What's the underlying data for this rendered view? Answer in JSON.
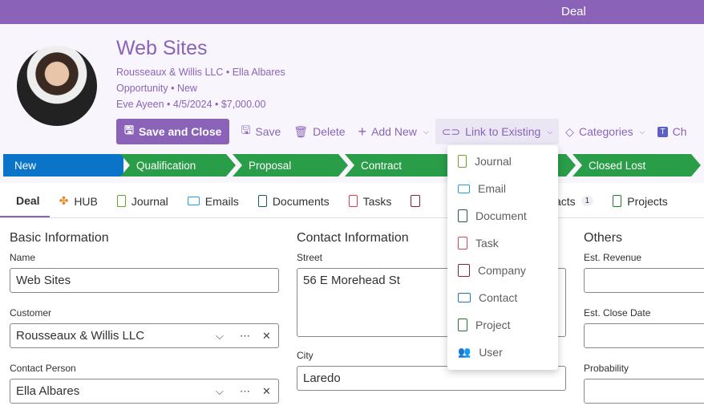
{
  "topbar": {
    "title": "Deal"
  },
  "header": {
    "title": "Web Sites",
    "line1": "Rousseaux & Willis LLC  •  Ella Albares",
    "line2": "Opportunity  •  New",
    "line3": "Eve Ayeen  •  4/5/2024  •  $7,000.00"
  },
  "toolbar": {
    "save_close": "Save and Close",
    "save": "Save",
    "delete": "Delete",
    "add_new": "Add New",
    "link_existing": "Link to Existing",
    "categories": "Categories",
    "chat": "Ch"
  },
  "stages": [
    {
      "label": "New",
      "color": "#0a74c9"
    },
    {
      "label": "Qualification",
      "color": "#2a9d48"
    },
    {
      "label": "Proposal",
      "color": "#2a9d48"
    },
    {
      "label": "Contract",
      "color": "#2a9d48"
    },
    {
      "label": "",
      "color": "#2a9d48"
    },
    {
      "label": "Closed Lost",
      "color": "#2a9d48"
    }
  ],
  "tabs": [
    {
      "label": "Deal"
    },
    {
      "label": "HUB"
    },
    {
      "label": "Journal"
    },
    {
      "label": "Emails"
    },
    {
      "label": "Documents"
    },
    {
      "label": "Tasks"
    },
    {
      "label": ""
    },
    {
      "label": "Contacts",
      "badge": "1"
    },
    {
      "label": "Projects"
    }
  ],
  "form": {
    "basic": {
      "heading": "Basic Information",
      "name_label": "Name",
      "name": "Web Sites",
      "customer_label": "Customer",
      "customer": "Rousseaux & Willis LLC",
      "contact_label": "Contact Person",
      "contact": "Ella Albares"
    },
    "contact": {
      "heading": "Contact Information",
      "street_label": "Street",
      "street": "56 E Morehead St",
      "city_label": "City",
      "city": "Laredo"
    },
    "others": {
      "heading": "Others",
      "revenue_label": "Est. Revenue",
      "close_label": "Est. Close Date",
      "prob_label": "Probability"
    }
  },
  "menu": {
    "items": [
      {
        "label": "Journal",
        "color": "#6aa32a"
      },
      {
        "label": "Email",
        "color": "#1ea0e6"
      },
      {
        "label": "Document",
        "color": "#1d5b5b"
      },
      {
        "label": "Task",
        "color": "#e0404f"
      },
      {
        "label": "Company",
        "color": "#8a1f2f"
      },
      {
        "label": "Contact",
        "color": "#1a73c9"
      },
      {
        "label": "Project",
        "color": "#1f7a2f"
      },
      {
        "label": "User",
        "color": "#2e6b8a"
      }
    ]
  }
}
